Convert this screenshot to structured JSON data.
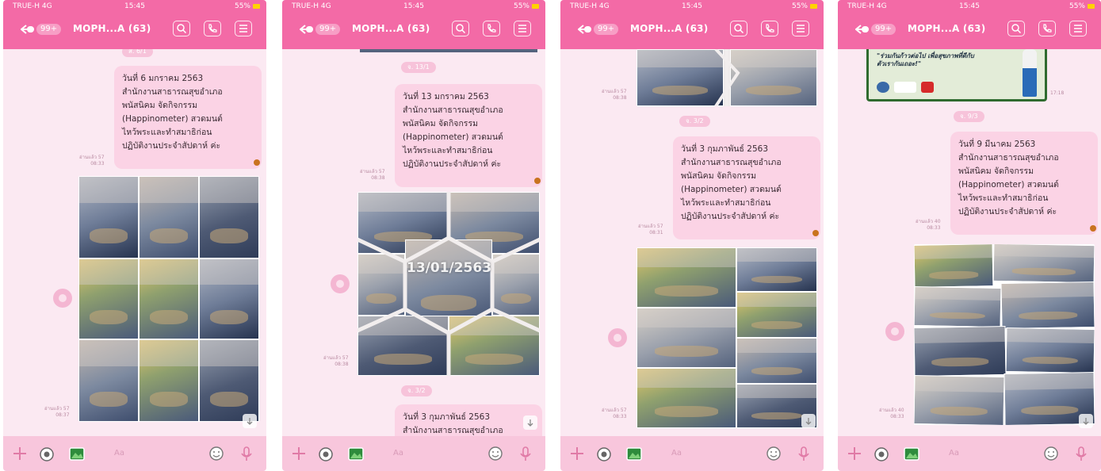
{
  "screens": [
    {
      "status": {
        "carrier": "TRUE-H 4G",
        "time": "15:45",
        "right": "55%"
      },
      "header": {
        "badge": "99+",
        "title": "MOPH...A (63)"
      },
      "date_pills": [
        "ส. 6/1"
      ],
      "message": {
        "lines": [
          "วันที่ 6 มกราคม 2563",
          "สำนักงานสาธารณสุขอำเภอ",
          "พนัสนิคม จัดกิจกรรม",
          "(Happinometer) สวดมนต์",
          "ไหว้พระและทำสมาธิก่อน",
          "ปฏิบัติงานประจำสัปดาห์ ค่ะ"
        ],
        "meta": [
          "อ่านแล้ว 57",
          "08:33"
        ]
      },
      "photo_meta": [
        "อ่านแล้ว 57",
        "08:37"
      ],
      "input_placeholder": "Aa"
    },
    {
      "status": {
        "carrier": "TRUE-H 4G",
        "time": "15:45",
        "right": "55%"
      },
      "header": {
        "badge": "99+",
        "title": "MOPH...A (63)"
      },
      "date_pills": [
        "จ. 13/1",
        "จ. 3/2"
      ],
      "message": {
        "lines": [
          "วันที่ 13 มกราคม 2563",
          "สำนักงานสาธารณสุขอำเภอ",
          "พนัสนิคม จัดกิจกรรม",
          "(Happinometer) สวดมนต์",
          "ไหว้พระและทำสมาธิก่อน",
          "ปฏิบัติงานประจำสัปดาห์ ค่ะ"
        ],
        "meta": [
          "อ่านแล้ว 57",
          "08:38"
        ]
      },
      "photo_meta": [
        "อ่านแล้ว 57",
        "08:38"
      ],
      "collage_date": "13/01/2563",
      "next_message": {
        "lines": [
          "วันที่ 3 กุมภาพันธ์ 2563",
          "สำนักงานสาธารณสุขอำเภอ"
        ]
      },
      "input_placeholder": "Aa"
    },
    {
      "status": {
        "carrier": "TRUE-H 4G",
        "time": "15:45",
        "right": "55%"
      },
      "header": {
        "badge": "99+",
        "title": "MOPH...A (63)"
      },
      "date_pills": [
        "จ. 3/2"
      ],
      "top_meta": [
        "อ่านแล้ว 57",
        "08:38"
      ],
      "message": {
        "lines": [
          "วันที่ 3 กุมภาพันธ์ 2563",
          "สำนักงานสาธารณสุขอำเภอ",
          "พนัสนิคม จัดกิจกรรม",
          "(Happinometer) สวดมนต์",
          "ไหว้พระและทำสมาธิก่อน",
          "ปฏิบัติงานประจำสัปดาห์ ค่ะ"
        ],
        "meta": [
          "อ่านแล้ว 57",
          "08:31"
        ]
      },
      "photo_meta": [
        "อ่านแล้ว 57",
        "08:33"
      ],
      "input_placeholder": "Aa"
    },
    {
      "status": {
        "carrier": "TRUE-H 4G",
        "time": "15:45",
        "right": "55%"
      },
      "header": {
        "badge": "99+",
        "title": "MOPH...A (63)"
      },
      "date_pills": [
        "จ. 9/3"
      ],
      "ad_text": [
        "\"ร่วมกันก้าวต่อไป เพื่อสุขภาพที่ดีกับ",
        "ตัวเรากันเถอะ!\""
      ],
      "ad_meta": "17:18",
      "message": {
        "lines": [
          "วันที่ 9 มีนาคม 2563",
          "สำนักงานสาธารณสุขอำเภอ",
          "พนัสนิคม จัดกิจกรรม",
          "(Happinometer) สวดมนต์",
          "ไหว้พระและทำสมาธิก่อน",
          "ปฏิบัติงานประจำสัปดาห์ ค่ะ"
        ],
        "meta": [
          "อ่านแล้ว 40",
          "08:33"
        ]
      },
      "photo_meta": [
        "อ่านแล้ว 40",
        "08:33"
      ],
      "input_placeholder": "Aa"
    }
  ],
  "colors": {
    "accent": "#f36aa6",
    "bubble": "#fbd3e5",
    "background": "#fbe9f2"
  },
  "icons": [
    "back-arrow-icon",
    "search-icon",
    "phone-icon",
    "menu-icon",
    "plus-icon",
    "camera-icon",
    "image-icon",
    "emoji-icon",
    "microphone-icon",
    "scroll-down-icon"
  ]
}
